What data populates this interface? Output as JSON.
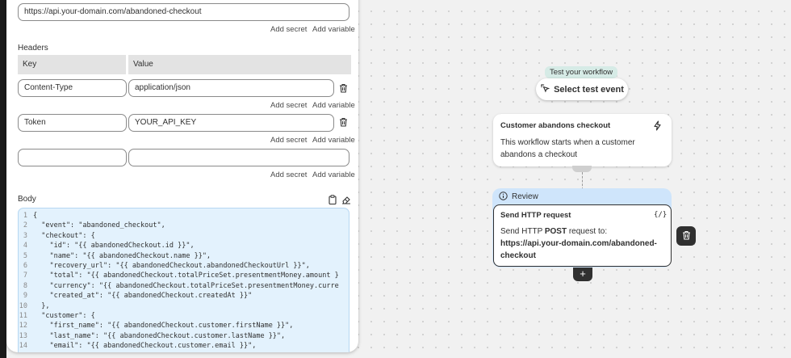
{
  "url_field": {
    "value": "https://api.your-domain.com/abandoned-checkout"
  },
  "add_secret": "Add secret",
  "add_variable": "Add variable",
  "headers": {
    "label": "Headers",
    "key_col": "Key",
    "value_col": "Value",
    "rows": [
      {
        "key": "Content-Type",
        "value": "application/json"
      },
      {
        "key": "Token",
        "value": "YOUR_API_KEY"
      },
      {
        "key": "",
        "value": ""
      }
    ]
  },
  "body": {
    "label": "Body",
    "lines": [
      {
        "n": "1",
        "text": "{"
      },
      {
        "n": "2",
        "text": "  \"event\": \"abandoned_checkout\","
      },
      {
        "n": "3",
        "text": "  \"checkout\": {"
      },
      {
        "n": "4",
        "text": "    \"id\": \"{{ abandonedCheckout.id }}\","
      },
      {
        "n": "5",
        "text": "    \"name\": \"{{ abandonedCheckout.name }}\","
      },
      {
        "n": "6",
        "text": "    \"recovery_url\": \"{{ abandonedCheckout.abandonedCheckoutUrl }}\","
      },
      {
        "n": "7",
        "text": "    \"total\": \"{{ abandonedCheckout.totalPriceSet.presentmentMoney.amount }"
      },
      {
        "n": "8",
        "text": "    \"currency\": \"{{ abandonedCheckout.totalPriceSet.presentmentMoney.curre"
      },
      {
        "n": "9",
        "text": "    \"created_at\": \"{{ abandonedCheckout.createdAt }}\""
      },
      {
        "n": "10",
        "text": "  },"
      },
      {
        "n": "11",
        "text": "  \"customer\": {"
      },
      {
        "n": "12",
        "text": "    \"first_name\": \"{{ abandonedCheckout.customer.firstName }}\","
      },
      {
        "n": "13",
        "text": "    \"last_name\": \"{{ abandonedCheckout.customer.lastName }}\","
      },
      {
        "n": "14",
        "text": "    \"email\": \"{{ abandonedCheckout.customer.email }}\","
      }
    ]
  },
  "canvas": {
    "test_badge": "Test your workflow",
    "test_button": "Select test event",
    "trigger_card": {
      "title": "Customer abandons checkout",
      "line1": "This workflow starts when a customer",
      "line2": "abandons a checkout"
    },
    "review_label": "Review",
    "action_card": {
      "title": "Send HTTP request",
      "code_icon": "{/}",
      "text_prefix": "Send HTTP ",
      "method": "POST",
      "text_suffix": " request to:",
      "url_line1": "https://api.your-domain.com/abandoned-",
      "url_line2": "checkout"
    },
    "plus_label": "+"
  },
  "icons": {
    "delete": "trash-icon",
    "copy": "clipboard-icon",
    "clear": "eraser-icon",
    "trigger": "lightning-icon",
    "info": "info-icon",
    "test": "cursor-click-icon"
  },
  "colors": {
    "review_bg": "#cfe5fb",
    "body_editor_bg": "#e3f2fd",
    "test_badge_bg": "#d6ebe6",
    "dark": "#303030"
  }
}
